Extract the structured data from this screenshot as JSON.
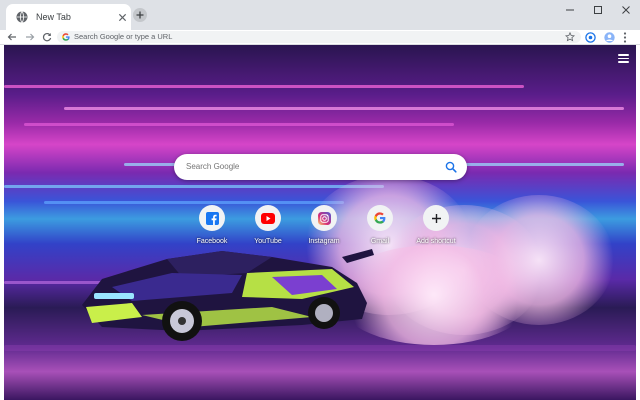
{
  "tab": {
    "title": "New Tab",
    "favicon": "globe-icon"
  },
  "omnibox": {
    "placeholder": "Search Google or type a URL"
  },
  "search": {
    "placeholder": "Search Google"
  },
  "shortcuts": [
    {
      "label": "Facebook",
      "icon": "facebook-icon",
      "color": "#1877f2"
    },
    {
      "label": "YouTube",
      "icon": "youtube-icon",
      "color": "#ff0000"
    },
    {
      "label": "Instagram",
      "icon": "instagram-icon",
      "color": "#c13584"
    },
    {
      "label": "Gmail",
      "icon": "google-icon",
      "color": "#4285f4"
    },
    {
      "label": "Add shortcut",
      "icon": "plus-icon",
      "color": "#202124"
    }
  ],
  "colors": {
    "tabstrip": "#dee1e6",
    "omnibox": "#f1f3f4",
    "accent": "#1a73e8"
  }
}
